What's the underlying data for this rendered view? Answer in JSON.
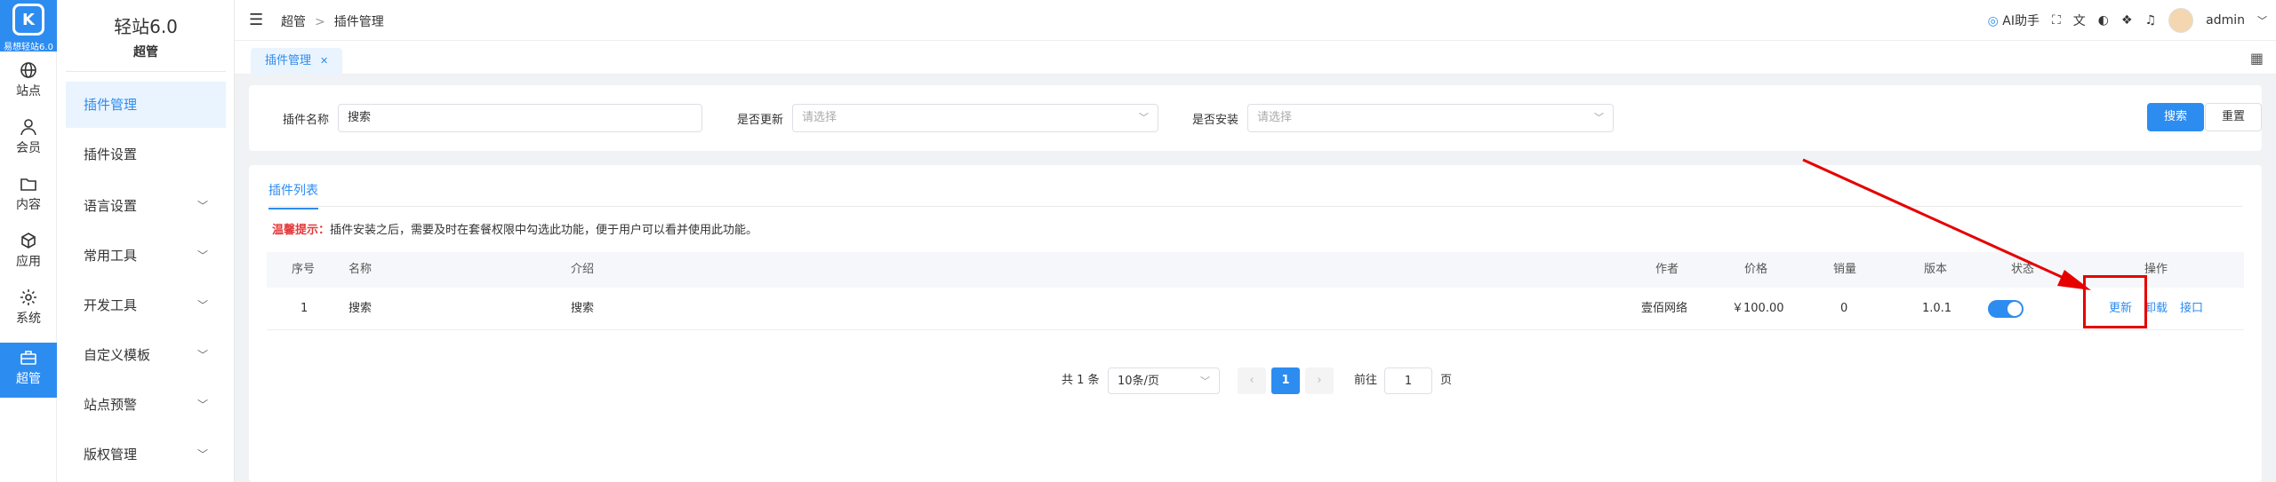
{
  "logo": {
    "text": "易想轻站6.0"
  },
  "rail": [
    {
      "label": "站点",
      "icon": "globe-icon"
    },
    {
      "label": "会员",
      "icon": "user-icon"
    },
    {
      "label": "内容",
      "icon": "folder-icon"
    },
    {
      "label": "应用",
      "icon": "cube-icon"
    },
    {
      "label": "系统",
      "icon": "gear-icon"
    },
    {
      "label": "超管",
      "icon": "briefcase-icon"
    }
  ],
  "sidebar": {
    "title": "轻站6.0",
    "subtitle": "超管",
    "items": [
      {
        "label": "插件管理"
      },
      {
        "label": "插件设置"
      },
      {
        "label": "语言设置"
      },
      {
        "label": "常用工具"
      },
      {
        "label": "开发工具"
      },
      {
        "label": "自定义模板"
      },
      {
        "label": "站点预警"
      },
      {
        "label": "版权管理"
      }
    ]
  },
  "topbar": {
    "breadcrumb": [
      "超管",
      "插件管理"
    ],
    "breadcrumb_sep": ">",
    "ai_label": "AI助手",
    "user": "admin"
  },
  "tabs": [
    {
      "label": "插件管理"
    }
  ],
  "filter": {
    "name_label": "插件名称",
    "name_value": "搜索",
    "update_label": "是否更新",
    "update_placeholder": "请选择",
    "install_label": "是否安装",
    "install_placeholder": "请选择",
    "search_btn": "搜索",
    "reset_btn": "重置"
  },
  "panel": {
    "tab": "插件列表",
    "tip_key": "温馨提示：",
    "tip_text": "插件安装之后，需要及时在套餐权限中勾选此功能，便于用户可以看并使用此功能。"
  },
  "table": {
    "headers": [
      "序号",
      "名称",
      "介绍",
      "作者",
      "价格",
      "销量",
      "版本",
      "状态",
      "操作"
    ],
    "rows": [
      {
        "index": "1",
        "name": "搜索",
        "intro": "搜索",
        "author": "壹佰网络",
        "price": "￥100.00",
        "sales": "0",
        "version": "1.0.1",
        "status_on": true,
        "ops": [
          "更新",
          "卸载",
          "接口"
        ]
      }
    ]
  },
  "pager": {
    "total": "共 1 条",
    "page_size": "10条/页",
    "current": "1",
    "goto_label": "前往",
    "goto_value": "1",
    "page_unit": "页"
  },
  "colors": {
    "accent": "#2d8cf0",
    "annotation": "#e60000"
  }
}
